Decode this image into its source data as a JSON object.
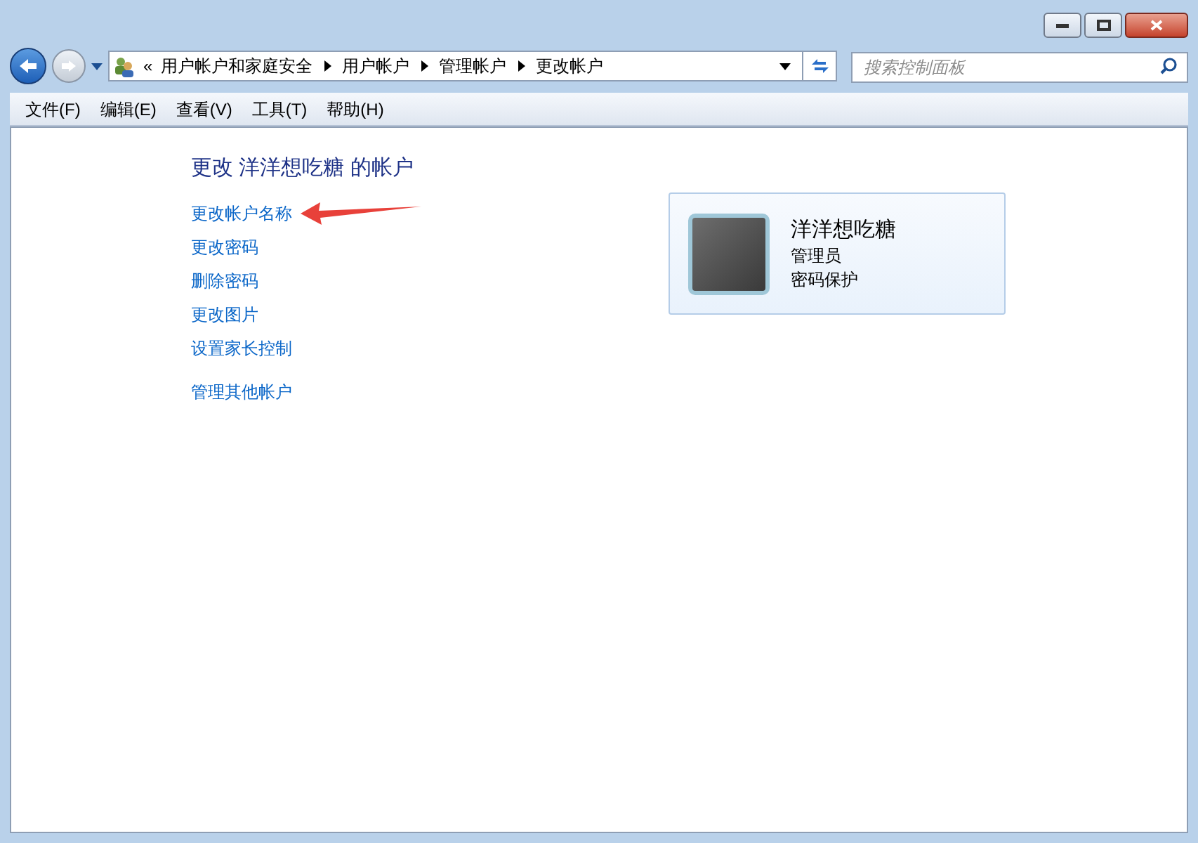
{
  "breadcrumb": {
    "overflow": "«",
    "items": [
      "用户帐户和家庭安全",
      "用户帐户",
      "管理帐户",
      "更改帐户"
    ]
  },
  "search": {
    "placeholder": "搜索控制面板"
  },
  "menu": [
    "文件(F)",
    "编辑(E)",
    "查看(V)",
    "工具(T)",
    "帮助(H)"
  ],
  "heading": "更改 洋洋想吃糖 的帐户",
  "tasks": [
    "更改帐户名称",
    "更改密码",
    "删除密码",
    "更改图片",
    "设置家长控制"
  ],
  "other_tasks": [
    "管理其他帐户"
  ],
  "account": {
    "name": "洋洋想吃糖",
    "role": "管理员",
    "status": "密码保护"
  }
}
